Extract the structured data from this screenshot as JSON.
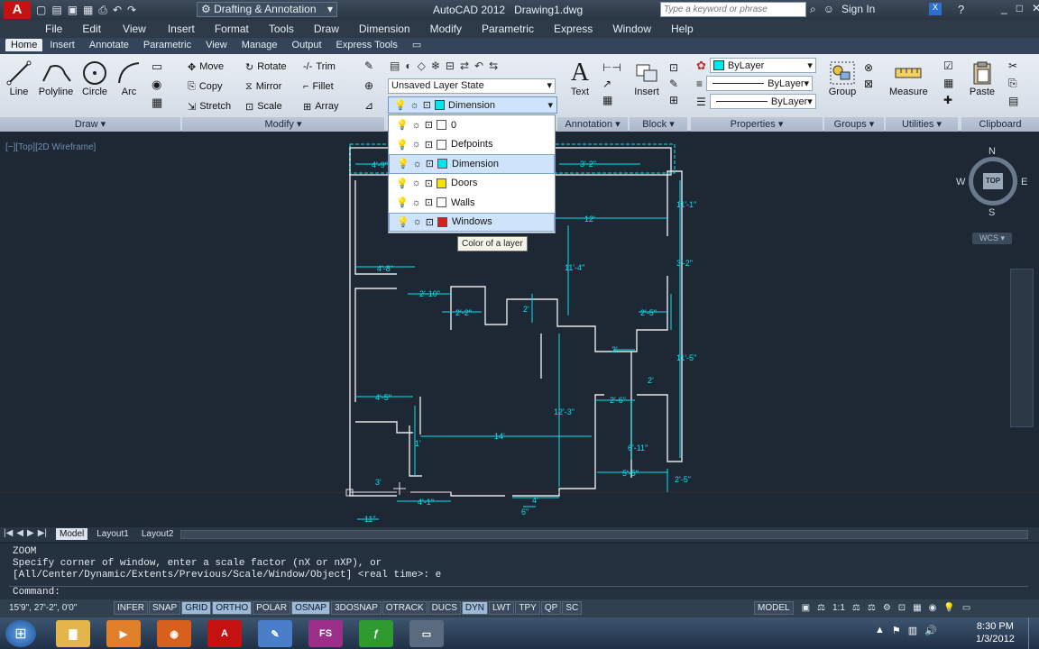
{
  "title_bar": {
    "workspace": "Drafting & Annotation",
    "app_title": "AutoCAD 2012",
    "file_name": "Drawing1.dwg",
    "search_placeholder": "Type a keyword or phrase",
    "sign_in": "Sign In"
  },
  "menu": [
    "File",
    "Edit",
    "View",
    "Insert",
    "Format",
    "Tools",
    "Draw",
    "Dimension",
    "Modify",
    "Parametric",
    "Express",
    "Window",
    "Help"
  ],
  "ribbon_tabs": [
    "Home",
    "Insert",
    "Annotate",
    "Parametric",
    "View",
    "Manage",
    "Output",
    "Express Tools"
  ],
  "draw_panel": {
    "line": "Line",
    "polyline": "Polyline",
    "circle": "Circle",
    "arc": "Arc",
    "label": "Draw"
  },
  "modify_panel": {
    "move": "Move",
    "rotate": "Rotate",
    "trim": "Trim",
    "copy": "Copy",
    "mirror": "Mirror",
    "fillet": "Fillet",
    "stretch": "Stretch",
    "scale": "Scale",
    "array": "Array",
    "label": "Modify"
  },
  "layers_panel": {
    "layer_state": "Unsaved Layer State",
    "current_layer": "Dimension"
  },
  "annotation_panel": {
    "text": "Text",
    "label": "Annotation"
  },
  "block_panel": {
    "insert": "Insert",
    "label": "Block"
  },
  "properties_panel": {
    "color": "ByLayer",
    "linetype": "ByLayer",
    "lineweight": "ByLayer",
    "label": "Properties"
  },
  "groups_panel": {
    "group": "Group",
    "label": "Groups"
  },
  "utilities_panel": {
    "measure": "Measure",
    "label": "Utilities"
  },
  "clipboard_panel": {
    "paste": "Paste",
    "label": "Clipboard"
  },
  "layer_dropdown": [
    {
      "name": "0",
      "color": "#ffffff",
      "selected": false
    },
    {
      "name": "Defpoints",
      "color": "#ffffff",
      "selected": false
    },
    {
      "name": "Dimension",
      "color": "#00e5ee",
      "selected": true
    },
    {
      "name": "Doors",
      "color": "#f5e400",
      "selected": false
    },
    {
      "name": "Walls",
      "color": "#ffffff",
      "selected": false
    },
    {
      "name": "Windows",
      "color": "#e41a1a",
      "selected": false
    }
  ],
  "tooltip": "Color of a layer",
  "viewport": {
    "label": "[−][Top][2D Wireframe]",
    "compass": {
      "n": "N",
      "s": "S",
      "e": "E",
      "w": "W",
      "top": "TOP"
    },
    "wcs": "WCS",
    "dims": [
      "4'-9\"",
      "3'-2\"",
      "12'",
      "4'-8\"",
      "2'-10\"",
      "2'-2\"",
      "2'",
      "11'-4\"",
      "3'",
      "2'-5\"",
      "3'-2\"",
      "11'-5\"",
      "2'",
      "4'-5\"",
      "2'-6\"",
      "12'-3\"",
      "14'",
      "6'-11\"",
      "5'-5\"",
      "2'-5\"",
      "3'",
      "1'",
      "4'-1\"",
      "4'",
      "6\"",
      "11\"",
      "11'-1\""
    ]
  },
  "layout_tabs": [
    "Model",
    "Layout1",
    "Layout2"
  ],
  "command_line": {
    "history": [
      "ZOOM",
      "Specify corner of window, enter a scale factor (nX or nXP), or",
      "[All/Center/Dynamic/Extents/Previous/Scale/Window/Object] <real time>: e"
    ],
    "prompt": "Command:"
  },
  "status_bar": {
    "coords": "15'9\", 27'-2\", 0'0\"",
    "toggles": [
      {
        "label": "INFER",
        "on": false
      },
      {
        "label": "SNAP",
        "on": false
      },
      {
        "label": "GRID",
        "on": true
      },
      {
        "label": "ORTHO",
        "on": true
      },
      {
        "label": "POLAR",
        "on": false
      },
      {
        "label": "OSNAP",
        "on": true
      },
      {
        "label": "3DOSNAP",
        "on": false
      },
      {
        "label": "OTRACK",
        "on": false
      },
      {
        "label": "DUCS",
        "on": false
      },
      {
        "label": "DYN",
        "on": true
      },
      {
        "label": "LWT",
        "on": false
      },
      {
        "label": "TPY",
        "on": false
      },
      {
        "label": "QP",
        "on": false
      },
      {
        "label": "SC",
        "on": false
      }
    ],
    "model": "MODEL",
    "scale": "1:1"
  },
  "taskbar": {
    "apps": [
      "windows-explorer",
      "media-player",
      "firefox",
      "autocad",
      "notepad",
      "fs",
      "camtasia",
      "windows-files"
    ],
    "fs_label": "FS",
    "time": "8:30 PM",
    "date": "1/3/2012"
  },
  "colors": {
    "dimension": "#00e5ee",
    "walls": "#ffffff",
    "background": "#1e2834"
  }
}
